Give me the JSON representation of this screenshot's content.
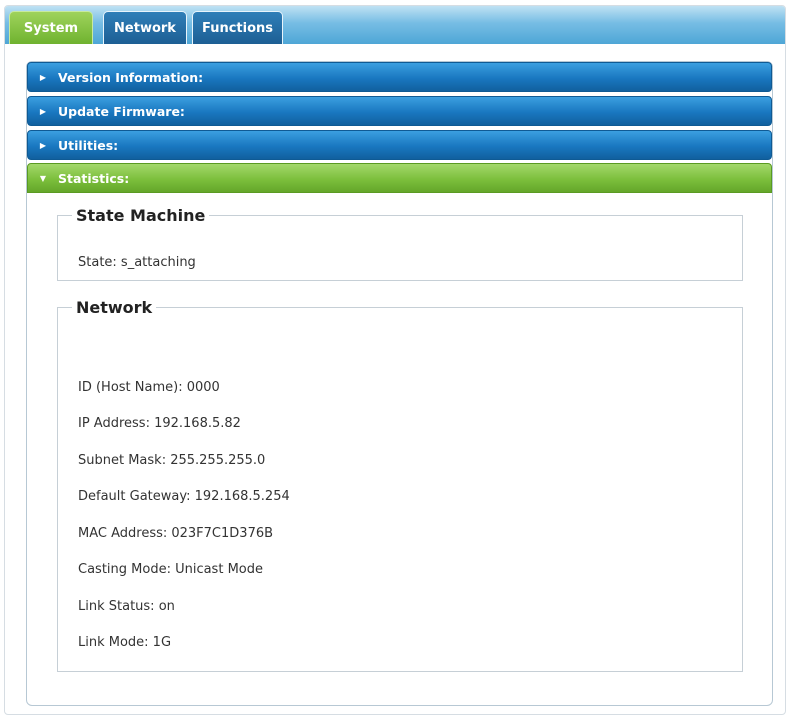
{
  "tabs": [
    "System",
    "Network",
    "Functions"
  ],
  "accordion": {
    "version": "Version Information:",
    "firmware": "Update Firmware:",
    "utilities": "Utilities:",
    "statistics": "Statistics:"
  },
  "state_machine": {
    "title": "State Machine",
    "state": "State: s_attaching"
  },
  "network": {
    "title": "Network",
    "lines": [
      "ID (Host Name): 0000",
      "IP Address: 192.168.5.82",
      "Subnet Mask: 255.255.255.0",
      "Default Gateway: 192.168.5.254",
      "MAC Address: 023F7C1D376B",
      "Casting Mode: Unicast Mode",
      "Link Status: on",
      "Link Mode: 1G"
    ]
  },
  "colors": {
    "active_tab": "#7cbf3c",
    "accordion_blue": "#1977c0",
    "accordion_green": "#7cbf3c"
  }
}
